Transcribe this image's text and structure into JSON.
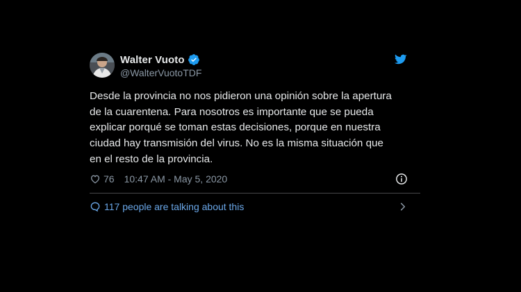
{
  "tweet": {
    "author": {
      "name": "Walter Vuoto",
      "handle": "@WalterVuotoTDF",
      "verified": true
    },
    "text": "Desde la provincia no nos pidieron una opinión sobre la apertura de la cuarentena. Para nosotros es importante que se pueda explicar porqué se toman estas decisiones, porque en nuestra ciudad hay transmisión del virus. No es la misma situación que en el resto de la provincia.",
    "likes": "76",
    "timestamp": "10:47 AM - May 5, 2020",
    "conversation_label": "117 people are talking about this",
    "icons": {
      "logo": "twitter-bird-icon",
      "verified": "verified-badge-icon",
      "like": "heart-icon",
      "info": "info-icon",
      "conversation": "speech-bubble-icon",
      "more": "chevron-right-icon"
    }
  },
  "colors": {
    "background": "#000000",
    "text": "#e7e9ea",
    "secondary_text": "#8b98a5",
    "link": "#6aa7e8",
    "twitter_blue": "#1d9bf0",
    "divider": "#48494b"
  }
}
